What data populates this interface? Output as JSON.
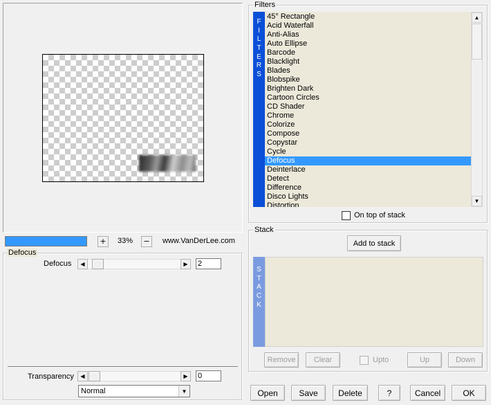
{
  "preview": {
    "zoom_in_label": "+",
    "zoom_value": "33%",
    "zoom_out_label": "−",
    "website": "www.VanDerLee.com"
  },
  "defocus_group": {
    "title": "Defocus",
    "param_label": "Defocus",
    "param_value": "2",
    "transparency_label": "Transparency",
    "transparency_value": "0",
    "blend_mode": "Normal"
  },
  "filters": {
    "title": "Filters",
    "strip_letters": [
      "F",
      "I",
      "L",
      "T",
      "E",
      "R",
      "S"
    ],
    "items": [
      "45° Rectangle",
      "Acid Waterfall",
      "Anti-Alias",
      "Auto Ellipse",
      "Barcode",
      "Blacklight",
      "Blades",
      "Blobspike",
      "Brighten Dark",
      "Cartoon Circles",
      "CD Shader",
      "Chrome",
      "Colorize",
      "Compose",
      "Copystar",
      "Cycle",
      "Defocus",
      "Deinterlace",
      "Detect",
      "Difference",
      "Disco Lights",
      "Distortion"
    ],
    "selected": "Defocus",
    "on_top_label": "On top of stack"
  },
  "stack": {
    "title": "Stack",
    "add_label": "Add to stack",
    "strip_letters": [
      "S",
      "T",
      "A",
      "C",
      "K"
    ],
    "remove_label": "Remove",
    "clear_label": "Clear",
    "upto_label": "Upto",
    "up_label": "Up",
    "down_label": "Down"
  },
  "bottom_buttons": {
    "open": "Open",
    "save": "Save",
    "delete": "Delete",
    "help": "?",
    "cancel": "Cancel",
    "ok": "OK"
  },
  "colors": {
    "accent_blue": "#0b4fd8",
    "progress_blue": "#3399ff",
    "stack_strip": "#7b9be0",
    "list_bg": "#ece9da"
  }
}
